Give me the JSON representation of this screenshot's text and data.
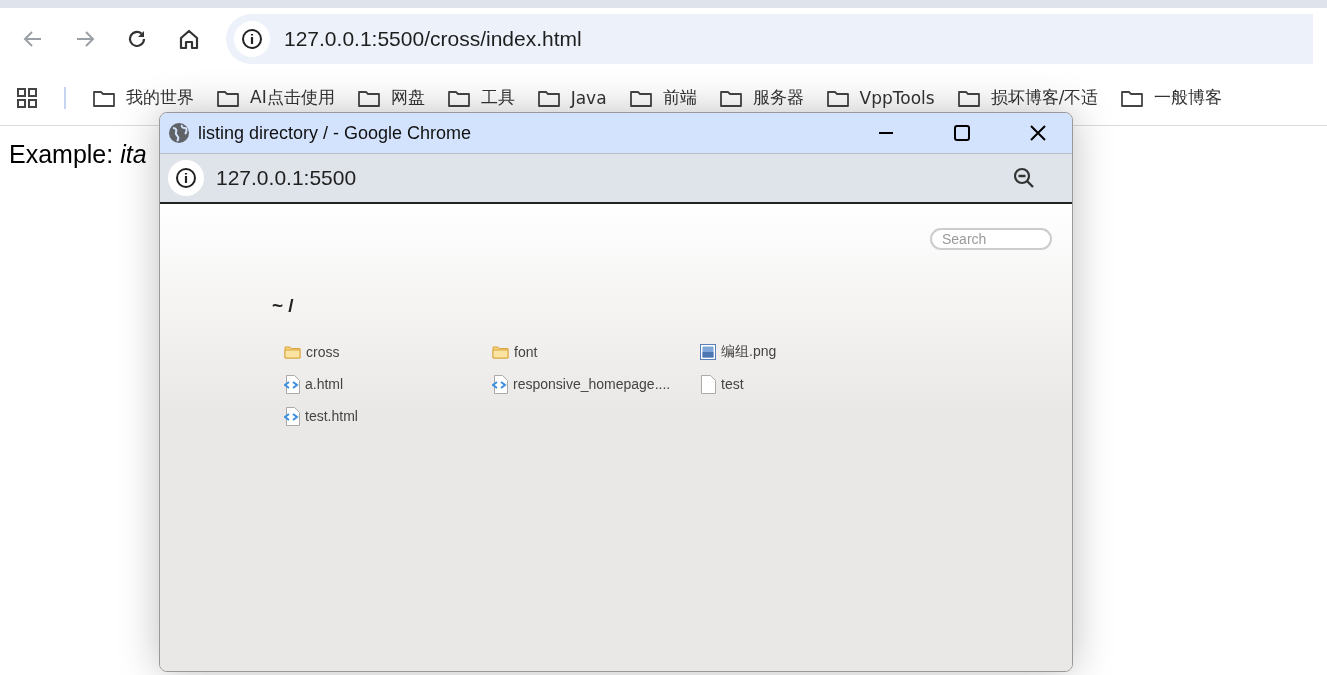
{
  "browser": {
    "url": "127.0.0.1:5500/cross/index.html",
    "bookmarks": [
      {
        "label": "我的世界"
      },
      {
        "label": "AI点击使用"
      },
      {
        "label": "网盘"
      },
      {
        "label": "工具"
      },
      {
        "label": "Java"
      },
      {
        "label": "前端"
      },
      {
        "label": "服务器"
      },
      {
        "label": "VppTools"
      },
      {
        "label": "损坏博客/不适"
      },
      {
        "label": "一般博客"
      }
    ]
  },
  "page": {
    "text": "Example: *ita*"
  },
  "popup": {
    "title": "listing directory / - Google Chrome",
    "url": "127.0.0.1:5500",
    "search": {
      "placeholder": "Search"
    },
    "heading": "~ /",
    "files": [
      {
        "name": "cross",
        "kind": "folder"
      },
      {
        "name": "font",
        "kind": "folder"
      },
      {
        "name": "编组.png",
        "kind": "image"
      },
      {
        "name": "a.html",
        "kind": "code"
      },
      {
        "name": "responsive_homepage....",
        "kind": "code"
      },
      {
        "name": "test",
        "kind": "file"
      },
      {
        "name": "test.html",
        "kind": "code"
      }
    ]
  }
}
